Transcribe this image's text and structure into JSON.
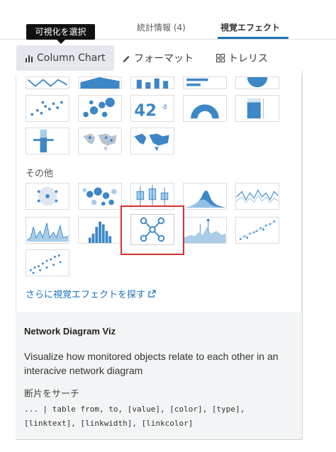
{
  "header": {
    "tabs": [
      {
        "label": "統計情報 (4)"
      },
      {
        "label": "視覚エフェクト"
      }
    ],
    "tooltip": "可視化を選択"
  },
  "toolbar": {
    "chart_type_label": "Column Chart",
    "format_label": "フォーマット",
    "trellis_label": "トレリス"
  },
  "gallery": {
    "other_section_title": "その他",
    "more_link": "さらに視覚エフェクトを探す",
    "single_value_text": "42",
    "single_value_delta": "-8"
  },
  "description": {
    "title": "Network Diagram Viz",
    "body": "Visualize how monitored objects relate to each other in an interacive network diagram",
    "search_heading": "断片をサーチ",
    "search_snippet": "... | table from, to, [value], [color], [type], [linktext], [linkwidth], [linkcolor]"
  },
  "colors": {
    "accent": "#1a73b8",
    "selection": "#d9302c",
    "thumb_blue": "#3d87c6",
    "thumb_light": "#a9cde8"
  }
}
